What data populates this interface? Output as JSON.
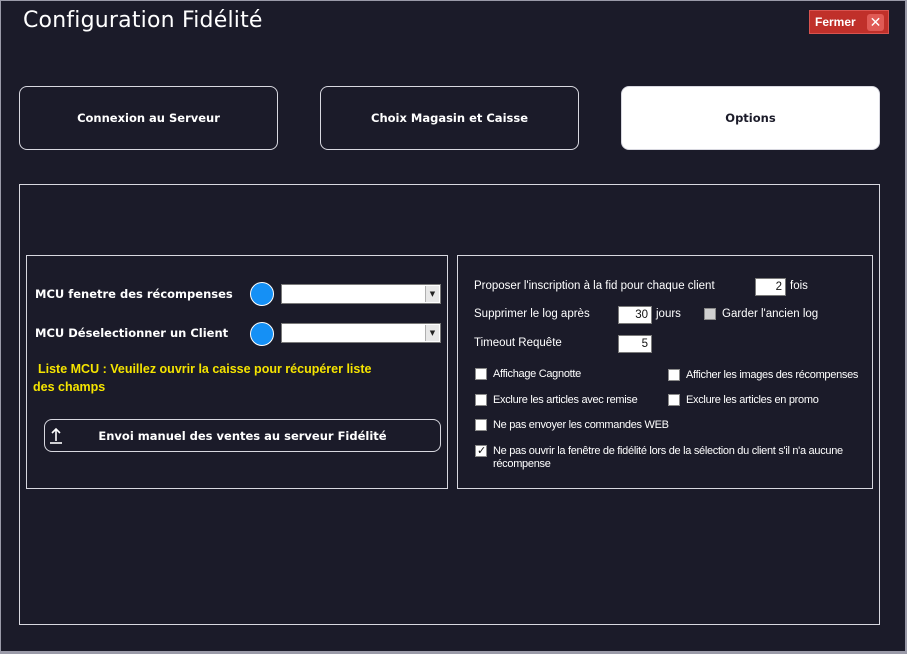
{
  "window": {
    "title": "Configuration Fidélité",
    "close_label": "Fermer",
    "close_icon": "x-icon",
    "close_color": "#c0302a"
  },
  "tabs": [
    {
      "label": "Connexion au Serveur",
      "active": false
    },
    {
      "label": "Choix Magasin et Caisse",
      "active": false
    },
    {
      "label": "Options",
      "active": true
    }
  ],
  "left_panel": {
    "mcu_rewards_label": "MCU fenetre des récompenses",
    "mcu_deselect_label": "MCU Déselectionner un Client",
    "mcu_rewards_value": "",
    "mcu_deselect_value": "",
    "dot_color": "#1590f5",
    "warning_line1": "Liste MCU : Veuillez ouvrir la caisse pour récupérer liste",
    "warning_line2": "des champs",
    "warning_color": "#f5e400",
    "send_button_label": "Envoi manuel des ventes au serveur Fidélité",
    "send_button_icon": "upload-icon"
  },
  "right_panel": {
    "propose_label": "Proposer l'inscription à la fid pour chaque client",
    "propose_value": "2",
    "propose_unit": "fois",
    "delete_log_label": "Supprimer le log après",
    "delete_log_value": "30",
    "delete_log_unit": "jours",
    "keep_log_label": "Garder l'ancien log",
    "keep_log_checked": false,
    "timeout_label": "Timeout Requête",
    "timeout_value": "5",
    "checkboxes": [
      {
        "label": "Affichage Cagnotte",
        "checked": false
      },
      {
        "label": "Afficher les images des récompenses",
        "checked": false
      },
      {
        "label": "Exclure les articles avec remise",
        "checked": false
      },
      {
        "label": "Exclure les articles en promo",
        "checked": false
      },
      {
        "label": "Ne pas envoyer les commandes WEB",
        "checked": false
      },
      {
        "label_line1": "Ne pas ouvrir la fenêtre de fidélité lors de la sélection du client s'il n'a aucune",
        "label_line2": "récompense",
        "checked": true
      }
    ]
  }
}
